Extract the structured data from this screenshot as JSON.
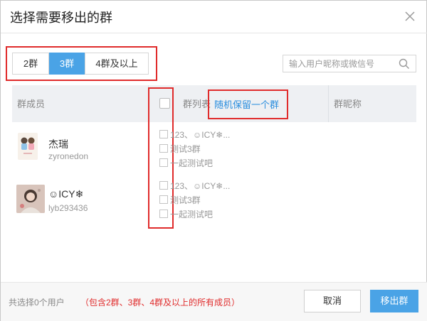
{
  "dialog": {
    "title": "选择需要移出的群",
    "close_icon": "close-icon"
  },
  "tabs": [
    {
      "label": "2群",
      "active": false
    },
    {
      "label": "3群",
      "active": true
    },
    {
      "label": "4群及以上",
      "active": false
    }
  ],
  "search": {
    "placeholder": "输入用户昵称或微信号",
    "value": "",
    "icon": "search-icon"
  },
  "table": {
    "headers": {
      "member": "群成员",
      "group_list": "群列表",
      "random_keep": "随机保留一个群",
      "nickname": "群昵称"
    },
    "rows": [
      {
        "name": "杰瑞",
        "id": "zyronedon",
        "groups": [
          "123、☺ICY❄...",
          "测试3群",
          "一起测试吧"
        ]
      },
      {
        "name": "☺ICY❄",
        "id": "lyb293436",
        "groups": [
          "123、☺ICY❄...",
          "测试3群",
          "一起测试吧"
        ]
      }
    ]
  },
  "footer": {
    "selected_count": "共选择0个用户",
    "note": "（包含2群、3群、4群及以上的所有成员）",
    "cancel_label": "取消",
    "remove_label": "移出群"
  },
  "colors": {
    "accent": "#4aa3e6",
    "highlight": "#e02b2b",
    "link": "#2b8ede"
  }
}
